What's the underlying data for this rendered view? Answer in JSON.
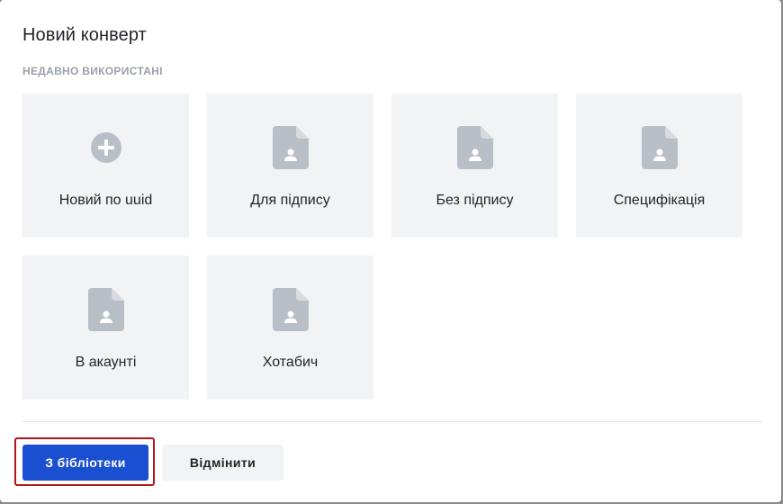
{
  "dialog": {
    "title": "Новий конверт",
    "section_label": "НЕДАВНО ВИКОРИСТАНІ",
    "tiles": [
      {
        "label": "Новий по uuid",
        "icon": "plus-circle-icon"
      },
      {
        "label": "Для підпису",
        "icon": "document-person-icon"
      },
      {
        "label": "Без підпису",
        "icon": "document-person-icon"
      },
      {
        "label": "Специфікація",
        "icon": "document-person-icon"
      },
      {
        "label": "В акаунті",
        "icon": "document-person-icon"
      },
      {
        "label": "Хотабич",
        "icon": "document-person-icon"
      }
    ],
    "buttons": {
      "library_label": "З бібліотеки",
      "cancel_label": "Відмінити"
    }
  },
  "colors": {
    "primary": "#1a4fd1",
    "tile_bg": "#f2f3f5",
    "icon_gray": "#b9bfc7",
    "focus_outline": "#b0141d"
  }
}
